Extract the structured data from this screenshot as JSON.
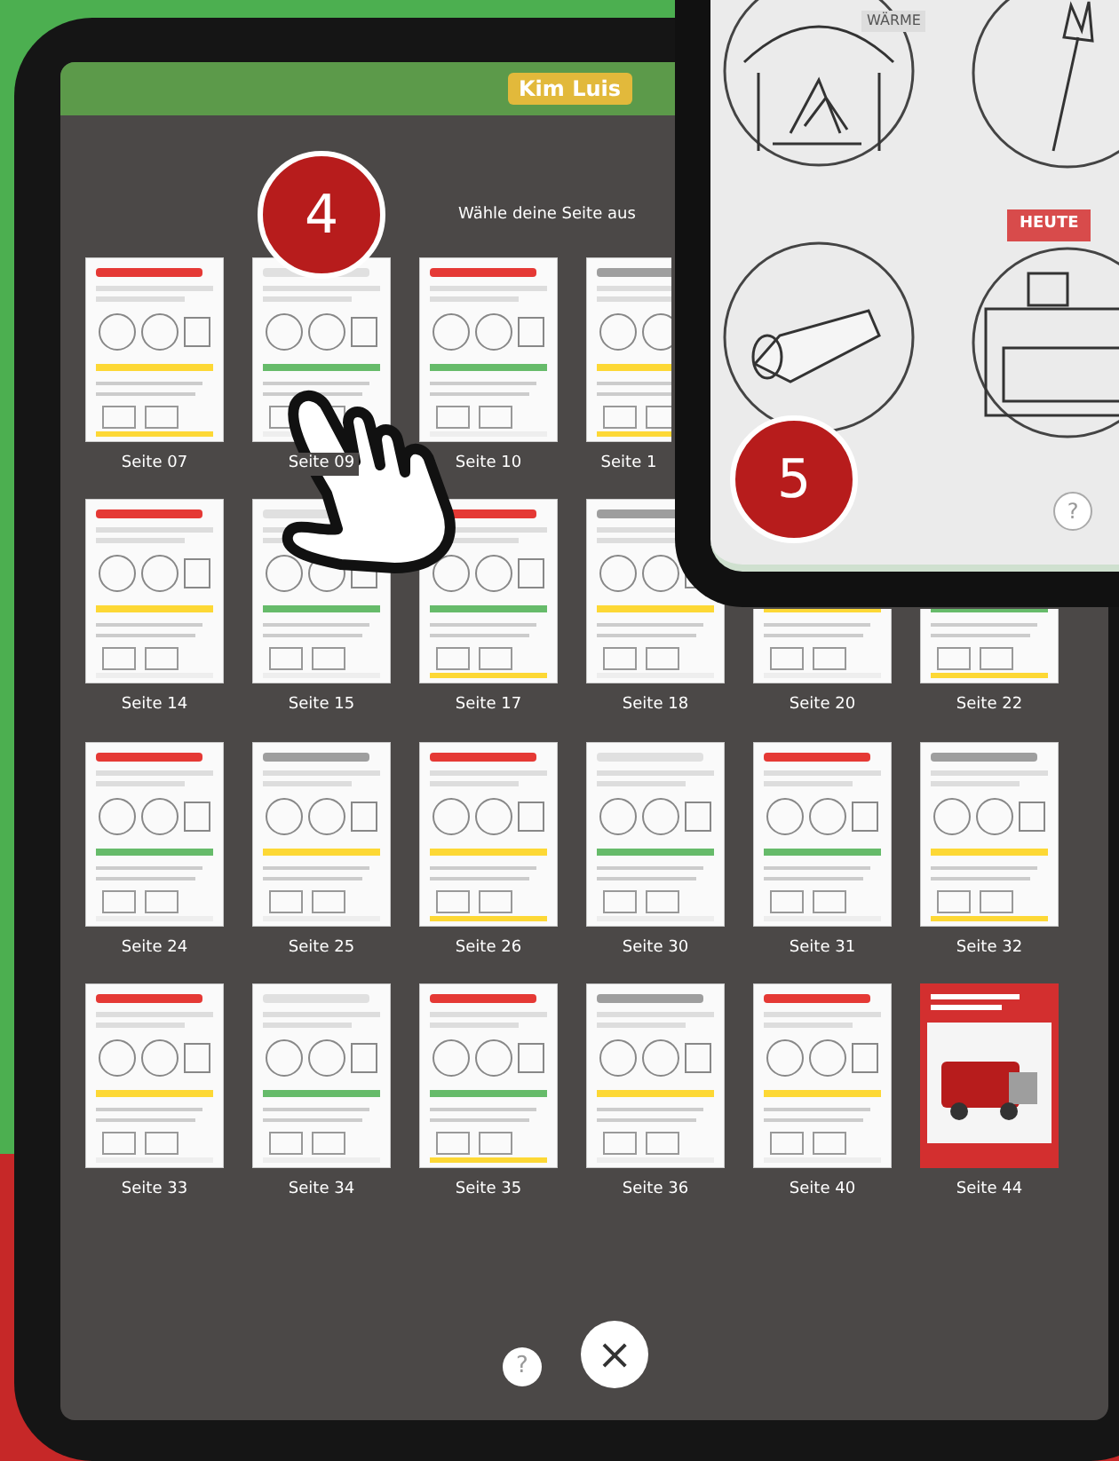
{
  "app": {
    "brand": "Kim Luis",
    "title": "Wähle deine Seite aus"
  },
  "rows": [
    [
      {
        "label": "Seite 07",
        "kind": "worksheet"
      },
      {
        "label": "Seite 09",
        "kind": "worksheet"
      },
      {
        "label": "Seite 10",
        "kind": "worksheet"
      },
      {
        "label": "Seite 1",
        "kind": "worksheet"
      }
    ],
    [
      {
        "label": "Seite 14",
        "kind": "worksheet"
      },
      {
        "label": "Seite 15",
        "kind": "worksheet"
      },
      {
        "label": "Seite 17",
        "kind": "worksheet"
      },
      {
        "label": "Seite 18",
        "kind": "worksheet"
      },
      {
        "label": "Seite 20",
        "kind": "worksheet"
      },
      {
        "label": "Seite 22",
        "kind": "worksheet"
      }
    ],
    [
      {
        "label": "Seite 24",
        "kind": "worksheet"
      },
      {
        "label": "Seite 25",
        "kind": "worksheet"
      },
      {
        "label": "Seite 26",
        "kind": "worksheet"
      },
      {
        "label": "Seite 30",
        "kind": "worksheet"
      },
      {
        "label": "Seite 31",
        "kind": "worksheet"
      },
      {
        "label": "Seite 32",
        "kind": "worksheet"
      }
    ],
    [
      {
        "label": "Seite 33",
        "kind": "worksheet"
      },
      {
        "label": "Seite 34",
        "kind": "worksheet"
      },
      {
        "label": "Seite 35",
        "kind": "worksheet"
      },
      {
        "label": "Seite 36",
        "kind": "worksheet"
      },
      {
        "label": "Seite 40",
        "kind": "worksheet"
      },
      {
        "label": "Seite 44",
        "kind": "cover"
      }
    ]
  ],
  "footer": {
    "help": "?",
    "close": "×"
  },
  "callouts": [
    "4",
    "5"
  ],
  "second_screen": {
    "warmth_label": "WÄRME",
    "today_tag": "HEUTE",
    "help": "?"
  }
}
